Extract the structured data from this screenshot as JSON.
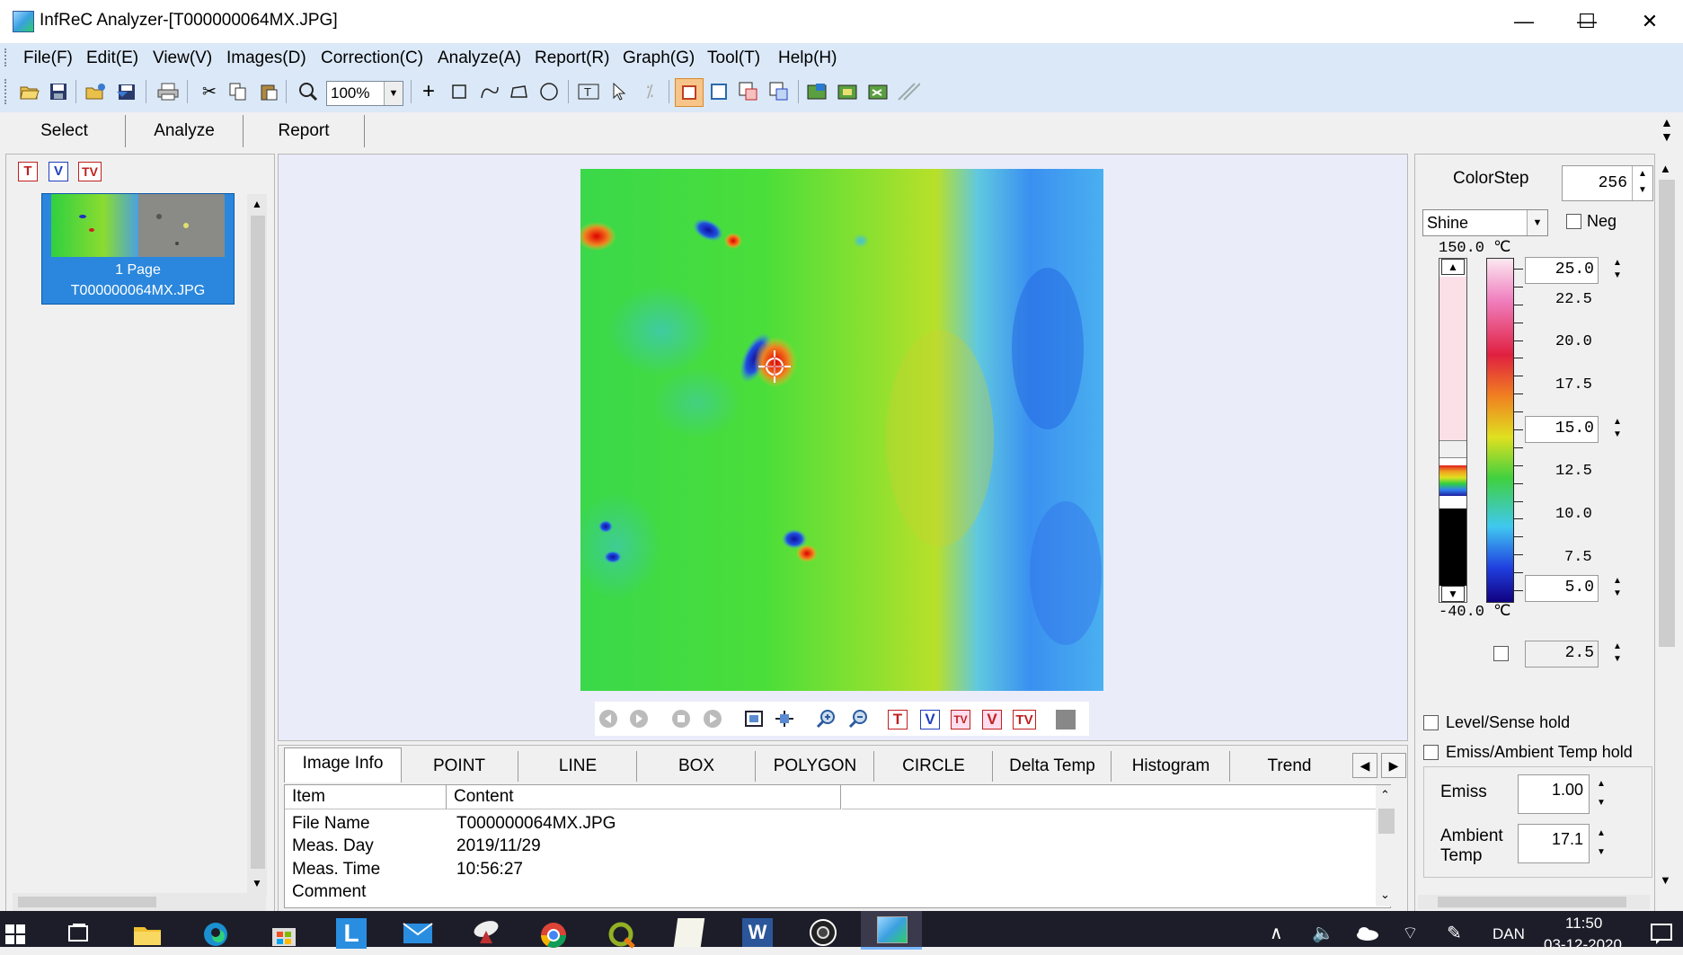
{
  "window": {
    "title": "InfReC Analyzer-[T000000064MX.JPG]",
    "controls": {
      "minimize": "—",
      "maximize": "☐",
      "close": "✕"
    }
  },
  "menu": [
    "File(F)",
    "Edit(E)",
    "View(V)",
    "Images(D)",
    "Correction(C)",
    "Analyze(A)",
    "Report(R)",
    "Graph(G)",
    "Tool(T)",
    "Help(H)"
  ],
  "toolbar": {
    "zoom_value": "100%",
    "icons": [
      "open-icon",
      "save-icon",
      "batch-open-icon",
      "batch-save-icon",
      "print-icon",
      "cut-icon",
      "copy-icon",
      "paste-icon",
      "zoom-icon",
      "point-tool-icon",
      "box-tool-icon",
      "line-tool-icon",
      "polygon-tool-icon",
      "circle-tool-icon",
      "text-tool-icon",
      "pointer-icon",
      "delete-tool-icon",
      "frame-icon",
      "area-icon",
      "merge-icon",
      "compare-icon",
      "image-export-icon",
      "image-import-icon",
      "image-swap-icon",
      "stripes-icon"
    ]
  },
  "top_tabs": [
    "Select",
    "Analyze",
    "Report"
  ],
  "left_panel": {
    "filter_icons": [
      "T",
      "V",
      "TV"
    ],
    "thumbnail": {
      "page": "1 Page",
      "filename": "T000000064MX.JPG"
    }
  },
  "player_icons": [
    "rewind-icon",
    "step-icon",
    "stop-icon",
    "play-icon",
    "fit-icon",
    "pan-icon",
    "zoom-in-icon",
    "zoom-out-icon",
    "T",
    "V",
    "TV",
    "V",
    "TV",
    "gray-box-icon"
  ],
  "bottom_tabs": [
    "Image Info",
    "POINT",
    "LINE",
    "BOX",
    "POLYGON",
    "CIRCLE",
    "Delta Temp",
    "Histogram",
    "Trend"
  ],
  "info_table": {
    "columns": [
      "Item",
      "Content"
    ],
    "rows": [
      {
        "item": "File Name",
        "content": "T000000064MX.JPG"
      },
      {
        "item": "Meas. Day",
        "content": "2019/11/29"
      },
      {
        "item": "Meas. Time",
        "content": "10:56:27"
      },
      {
        "item": "Comment",
        "content": ""
      }
    ]
  },
  "right_panel": {
    "colorstep_label": "ColorStep",
    "colorstep_value": "256",
    "palette": "Shine",
    "neg_label": "Neg",
    "range_top": "150.0 ℃",
    "range_bottom": "-40.0 ℃",
    "level_high": "25.0",
    "level_mid": "15.0",
    "level_low": "5.0",
    "scale_labels": [
      "22.5",
      "20.0",
      "17.5",
      "12.5",
      "10.0",
      "7.5"
    ],
    "step_value": "2.5",
    "level_sense_hold": "Level/Sense hold",
    "emiss_ambient_hold": "Emiss/Ambient Temp hold",
    "emiss_label": "Emiss",
    "emiss_value": "1.00",
    "ambient_label_1": "Ambient",
    "ambient_label_2": "Temp",
    "ambient_value": "17.1"
  },
  "taskbar": {
    "language": "DAN",
    "time": "11:50",
    "date": "03-12-2020"
  },
  "colors": {
    "menubar": "#dbe8f7",
    "selection": "#2a87dd",
    "taskbar": "#1d1d2a"
  }
}
